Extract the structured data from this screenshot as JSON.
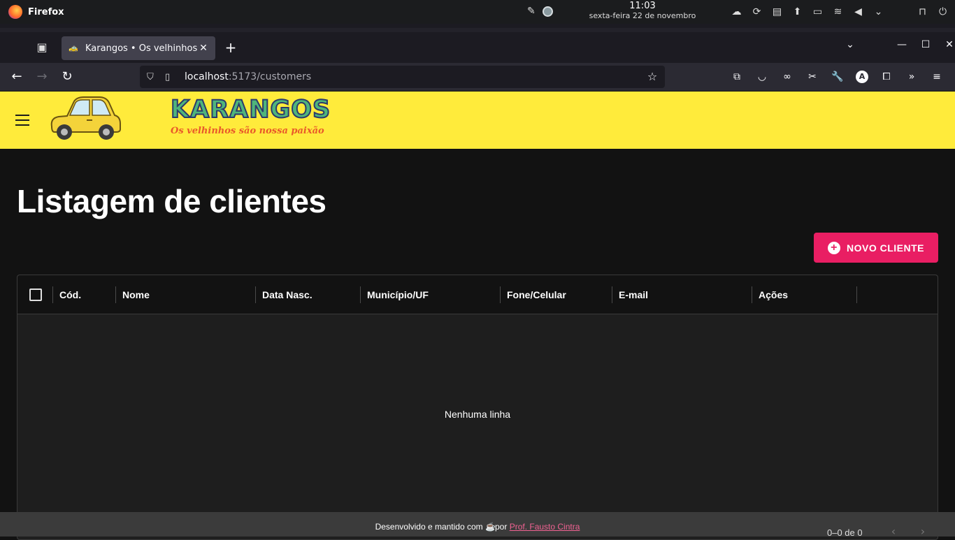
{
  "system": {
    "app_name": "Firefox",
    "time": "11:03",
    "date": "sexta-feira 22 de novembro"
  },
  "browser": {
    "tab_title": "Karangos • Os velhinhos s",
    "url_host": "localhost",
    "url_path": ":5173/customers"
  },
  "header": {
    "logo_title": "KARANGOS",
    "logo_subtitle": "Os velhinhos são nossa paixão"
  },
  "page": {
    "title": "Listagem de clientes",
    "new_button_label": "NOVO CLIENTE"
  },
  "grid": {
    "columns": [
      "Cód.",
      "Nome",
      "Data Nasc.",
      "Município/UF",
      "Fone/Celular",
      "E-mail",
      "Ações"
    ],
    "empty_text": "Nenhuma linha",
    "pagination_text": "0–0 de 0"
  },
  "footer": {
    "text_before": "Desenvolvido e mantido com",
    "text_by": "por",
    "author_link": "Prof. Fausto Cintra"
  },
  "colors": {
    "appbar": "#ffeb3b",
    "accent": "#e91e63",
    "background": "#121212"
  }
}
